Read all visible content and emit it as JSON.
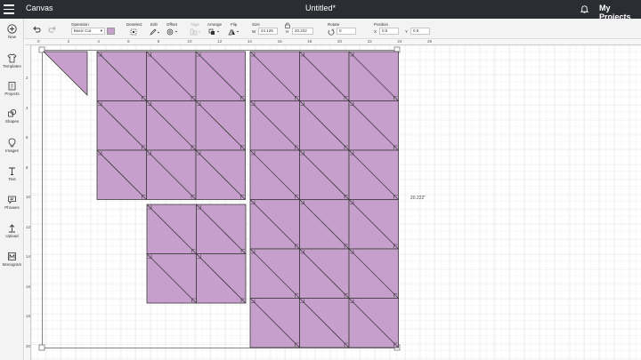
{
  "topbar": {
    "app_name": "Canvas",
    "doc_title": "Untitled*",
    "projects_label": "My Projects"
  },
  "toolbar": {
    "operation_label": "Operation",
    "operation_value": "Basic Cut",
    "operation_color": "#c79fcd",
    "deselect_label": "Deselect",
    "edit_label": "Edit",
    "offset_label": "Offset",
    "align_label": "Align",
    "arrange_label": "Arrange",
    "flip_label": "Flip",
    "size_label": "Size",
    "w_label": "W",
    "w_value": "24.125",
    "h_label": "H",
    "h_value": "20.222",
    "rotate_label": "Rotate",
    "rotate_value": "0",
    "position_label": "Position",
    "x_label": "X",
    "x_value": "0.5",
    "y_label": "Y",
    "y_value": "0.5"
  },
  "sidebar": {
    "items": [
      {
        "label": "New",
        "icon": "plus-circle-icon"
      },
      {
        "label": "Templates",
        "icon": "shirt-icon"
      },
      {
        "label": "Projects",
        "icon": "projects-icon"
      },
      {
        "label": "Shapes",
        "icon": "shapes-icon"
      },
      {
        "label": "Images",
        "icon": "lightbulb-icon"
      },
      {
        "label": "Text",
        "icon": "text-icon"
      },
      {
        "label": "Phrases",
        "icon": "speech-bubble-icon"
      },
      {
        "label": "Upload",
        "icon": "upload-icon"
      },
      {
        "label": "Monogram",
        "icon": "monogram-icon"
      }
    ]
  },
  "rulers": {
    "top": [
      "0",
      "2",
      "4",
      "6",
      "8",
      "10",
      "12",
      "14",
      "16",
      "18",
      "20",
      "22",
      "24",
      "26"
    ],
    "left": [
      "2",
      "4",
      "6",
      "8",
      "10",
      "12",
      "14",
      "16",
      "18",
      "20"
    ]
  },
  "canvas": {
    "height_dimension": "20.222\"",
    "block_color": "#c79fcd"
  }
}
